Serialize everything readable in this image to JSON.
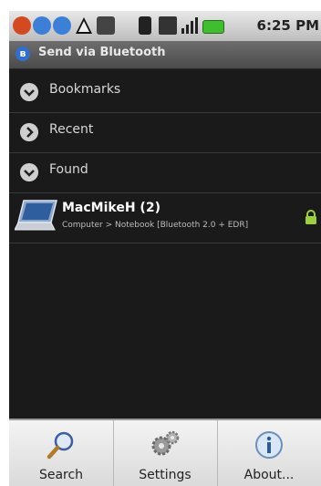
{
  "status_bar": {
    "time": "6:25 PM"
  },
  "title_bar": {
    "title": "Send via Bluetooth"
  },
  "groups": [
    {
      "label": "Bookmarks",
      "state": "collapsed"
    },
    {
      "label": "Recent",
      "state": "collapsed"
    },
    {
      "label": "Found",
      "state": "expanded"
    }
  ],
  "device": {
    "name": "MacMikeH (2)",
    "detail": "Computer > Notebook [Bluetooth 2.0 + EDR]",
    "icon": "laptop-icon",
    "lock_icon": "lock-icon"
  },
  "menu": {
    "items": [
      {
        "label": "Search",
        "icon": "magnifier-icon"
      },
      {
        "label": "Settings",
        "icon": "gears-icon"
      },
      {
        "label": "About...",
        "icon": "info-icon"
      }
    ]
  },
  "colors": {
    "background": "#1a1a1a",
    "title_bar": "#5a5a5a",
    "menu": "#e8e8e8",
    "lock": "#9bd03c"
  }
}
